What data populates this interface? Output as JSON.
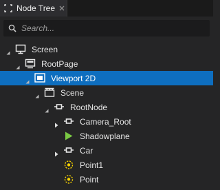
{
  "tab": {
    "label": "Node Tree",
    "close_glyph": "×"
  },
  "search": {
    "placeholder": "Search...",
    "value": ""
  },
  "colors": {
    "selection": "#0e6ebf",
    "icon_white": "#e8e8e8",
    "icon_green": "#7ac943",
    "icon_yellow": "#f5d100"
  },
  "tree": [
    {
      "label": "Screen",
      "icon": "monitor-icon",
      "depth": 0,
      "arrow": "expanded"
    },
    {
      "label": "RootPage",
      "icon": "page-icon",
      "depth": 1,
      "arrow": "expanded"
    },
    {
      "label": "Viewport 2D",
      "icon": "viewport-2d-icon",
      "depth": 2,
      "arrow": "expanded",
      "selected": true
    },
    {
      "label": "Scene",
      "icon": "scene-icon",
      "depth": 3,
      "arrow": "expanded"
    },
    {
      "label": "RootNode",
      "icon": "node-icon",
      "depth": 4,
      "arrow": "expanded"
    },
    {
      "label": "Camera_Root",
      "icon": "node-icon",
      "depth": 5,
      "arrow": "collapsed"
    },
    {
      "label": "Shadowplane",
      "icon": "mesh-icon",
      "depth": 5,
      "arrow": "none"
    },
    {
      "label": "Car",
      "icon": "node-icon",
      "depth": 5,
      "arrow": "collapsed"
    },
    {
      "label": "Point1",
      "icon": "point-light-icon",
      "depth": 5,
      "arrow": "none"
    },
    {
      "label": "Point",
      "icon": "point-light-icon",
      "depth": 5,
      "arrow": "none"
    }
  ]
}
